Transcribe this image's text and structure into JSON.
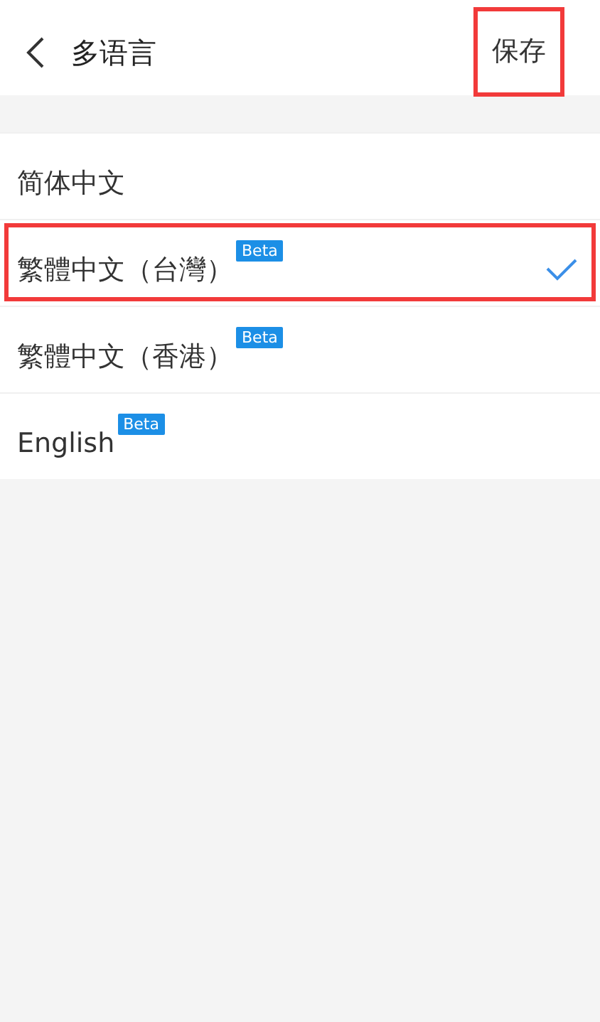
{
  "header": {
    "title": "多语言",
    "save_button": {
      "label": "保存",
      "highlighted": true
    }
  },
  "languages": [
    {
      "label": "简体中文",
      "selected": false,
      "highlighted": false
    },
    {
      "label": "繁體中文（台灣）",
      "badge": "Beta",
      "selected": true,
      "highlighted": true
    },
    {
      "label": "繁體中文（香港）",
      "badge": "Beta",
      "selected": false,
      "highlighted": false
    },
    {
      "label": "English",
      "badge": "Beta",
      "selected": false,
      "highlighted": false
    }
  ]
}
